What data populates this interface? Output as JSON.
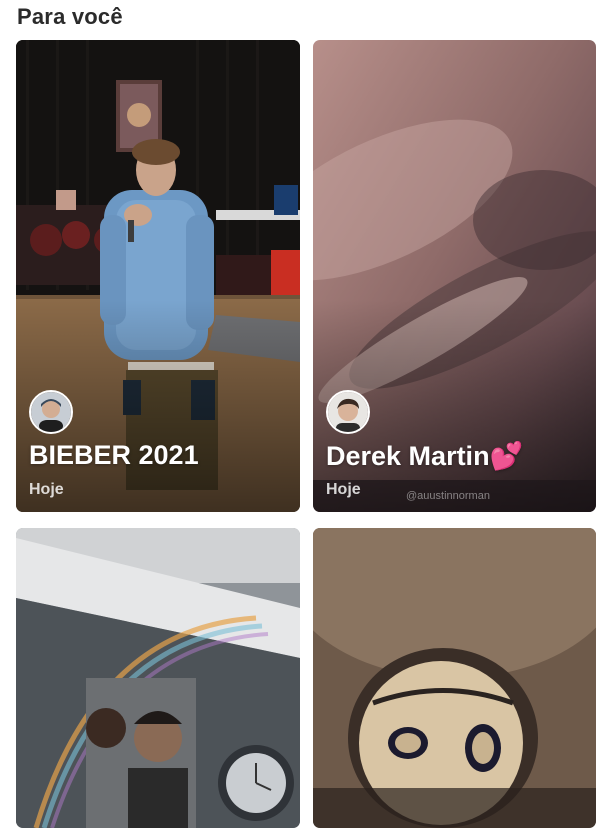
{
  "section": {
    "title": "Para você"
  },
  "cards": [
    {
      "title": "BIEBER 2021",
      "time": "Hoje"
    },
    {
      "title": "Derek Martin",
      "emoji": "💕",
      "time": "Hoje",
      "watermark": "@auustinnorman"
    },
    {
      "title": "",
      "time": ""
    },
    {
      "title": "",
      "time": ""
    }
  ]
}
